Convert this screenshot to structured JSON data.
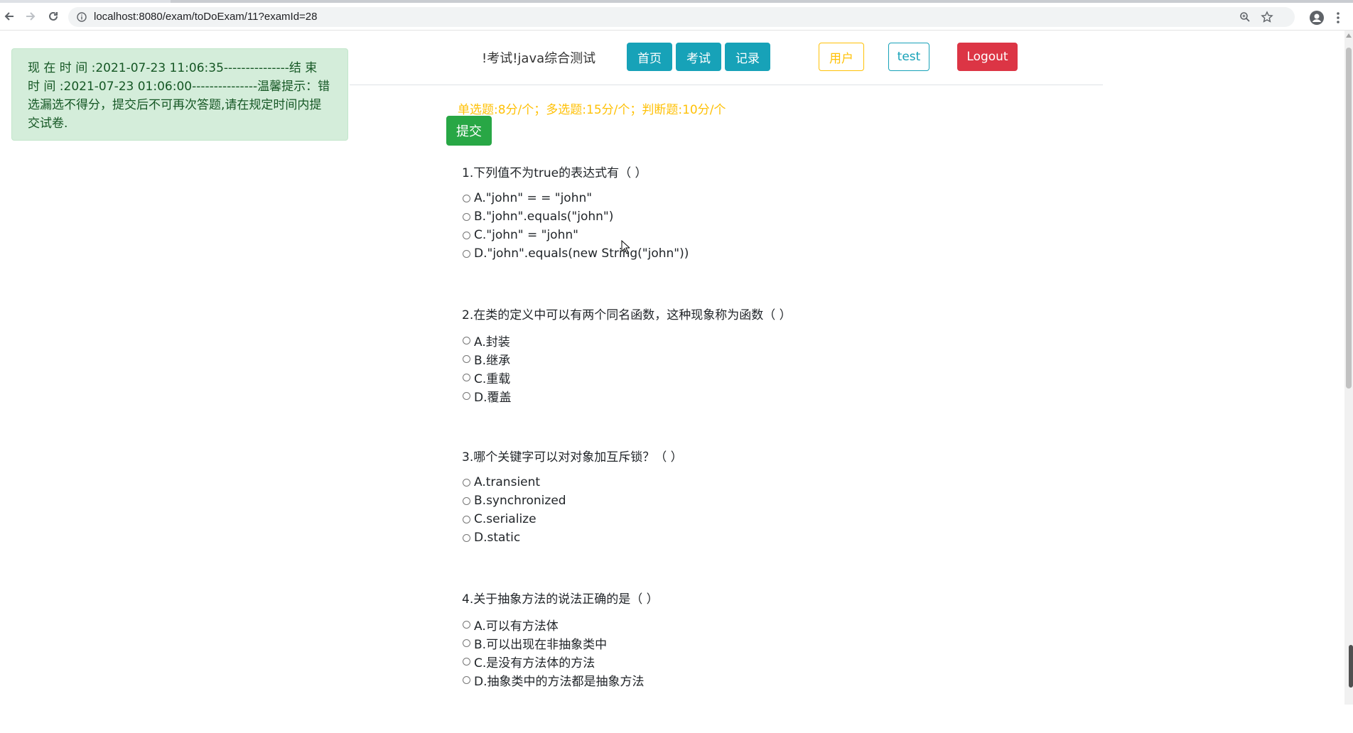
{
  "browser": {
    "url": "localhost:8080/exam/toDoExam/11?examId=28"
  },
  "notice": {
    "text": "现 在 时 间 :2021-07-23 11:06:35---------------结 束 时 间 :2021-07-23 01:06:00---------------温馨提示：错选漏选不得分，提交后不可再次答题,请在规定时间内提交试卷."
  },
  "header": {
    "exam_title": "!考试!java综合测试",
    "nav": {
      "home": "首页",
      "exam": "考试",
      "records": "记录",
      "user": "用户",
      "test": "test",
      "logout": "Logout"
    }
  },
  "score_rules": "单选题:8分/个；多选题:15分/个；判断题:10分/个",
  "submit_label": "提交",
  "questions": [
    {
      "text": "1.下列值不为true的表达式有（ ）",
      "options": [
        "A.\"john\" = = \"john\"",
        "B.\"john\".equals(\"john\")",
        "C.\"john\" = \"john\"",
        "D.\"john\".equals(new String(\"john\"))"
      ]
    },
    {
      "text": "2.在类的定义中可以有两个同名函数，这种现象称为函数（ ）",
      "options": [
        "A.封装",
        "B.继承",
        "C.重载",
        "D.覆盖"
      ]
    },
    {
      "text": "3.哪个关键字可以对对象加互斥锁？（ ）",
      "options": [
        "A.transient",
        "B.synchronized",
        "C.serialize",
        "D.static"
      ]
    },
    {
      "text": "4.关于抽象方法的说法正确的是（ ）",
      "options": [
        "A.可以有方法体",
        "B.可以出现在非抽象类中",
        "C.是没有方法体的方法",
        "D.抽象类中的方法都是抽象方法"
      ]
    }
  ]
}
